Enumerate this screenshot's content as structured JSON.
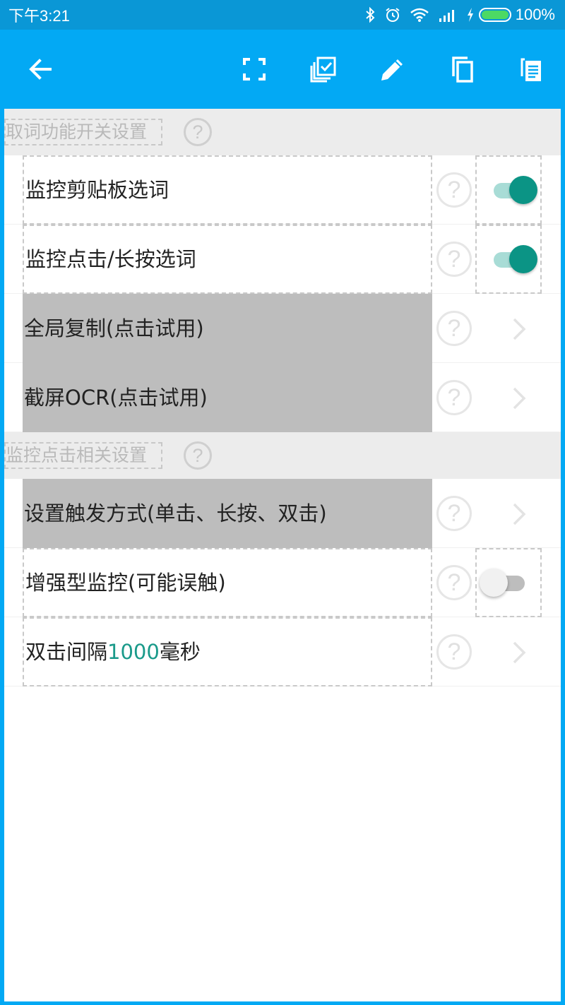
{
  "status_bar": {
    "time": "下午3:21",
    "battery_percent": "100%",
    "icons": [
      "bluetooth-icon",
      "alarm-icon",
      "wifi-icon",
      "signal-icon",
      "charging-icon",
      "battery-icon"
    ]
  },
  "toolbar": {
    "icons": [
      "back-arrow-icon",
      "fullscreen-icon",
      "select-all-icon",
      "edit-icon",
      "copy-icon",
      "paste-icon"
    ]
  },
  "sections": [
    {
      "title": "取词功能开关设置"
    },
    {
      "title": "监控点击相关设置"
    }
  ],
  "rows": {
    "monitor_clipboard": {
      "label": "监控剪贴板选词",
      "toggle_on": true
    },
    "monitor_click": {
      "label": "监控点击/长按选词",
      "toggle_on": true
    },
    "global_copy": {
      "label": "全局复制(点击试用)"
    },
    "screenshot_ocr": {
      "label": "截屏OCR(点击试用)"
    },
    "trigger_mode": {
      "label": "设置触发方式(单击、长按、双击)"
    },
    "enhanced_monitor": {
      "label": "增强型监控(可能误触)",
      "toggle_on": false
    },
    "double_click_interval": {
      "prefix": "双击间隔",
      "value": "1000",
      "suffix": "毫秒"
    }
  },
  "colors": {
    "toolbar": "#03a9f4",
    "status_bar": "#0a97d6",
    "accent": "#0b9485",
    "header_bg": "#ececec",
    "gray_row": "#bdbdbd"
  }
}
